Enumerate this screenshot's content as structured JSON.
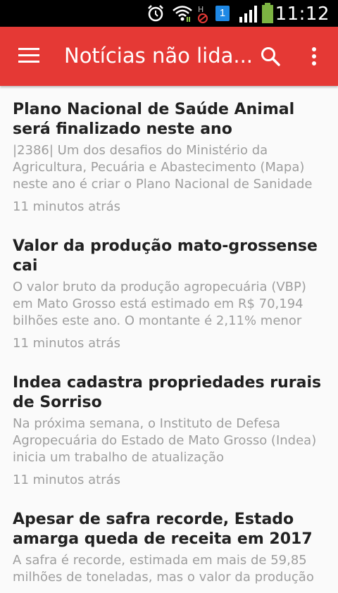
{
  "status_bar": {
    "time": "11:12",
    "icons": [
      "alarm-icon",
      "wifi-icon",
      "data-off-icon",
      "notification-icon",
      "signal-icon",
      "battery-icon"
    ],
    "notification_count": "1"
  },
  "app_bar": {
    "title": "Notícias não lida...",
    "color": "#e53935",
    "menu_icon": "menu-icon",
    "search_icon": "search-icon",
    "more_icon": "more-vert-icon"
  },
  "articles": [
    {
      "title": "Plano Nacional de Saúde Animal será finalizado neste ano",
      "summary": "|2386| Um dos desafios do Ministério da Agricultura, Pecuária e Abastecimento (Mapa) neste ano é criar o Plano Nacional de Sanidade",
      "time": "11 minutos atrás"
    },
    {
      "title": "Valor da produção mato-grossense cai",
      "summary": "O valor bruto da produção agropecuária (VBP) em Mato Grosso está estimado em R$ 70,194 bilhões este ano. O montante é 2,11% menor",
      "time": "11 minutos atrás"
    },
    {
      "title": "Indea cadastra propriedades rurais de Sorriso",
      "summary": "Na próxima semana, o Instituto de Defesa Agropecuária do Estado de Mato Grosso (Indea) inicia um trabalho de atualização",
      "time": "11 minutos atrás"
    },
    {
      "title": "Apesar de safra recorde, Estado amarga queda de receita em 2017",
      "summary": "A safra é recorde, estimada em mais de 59,85 milhões de toneladas, mas o valor da produção",
      "time": ""
    }
  ]
}
